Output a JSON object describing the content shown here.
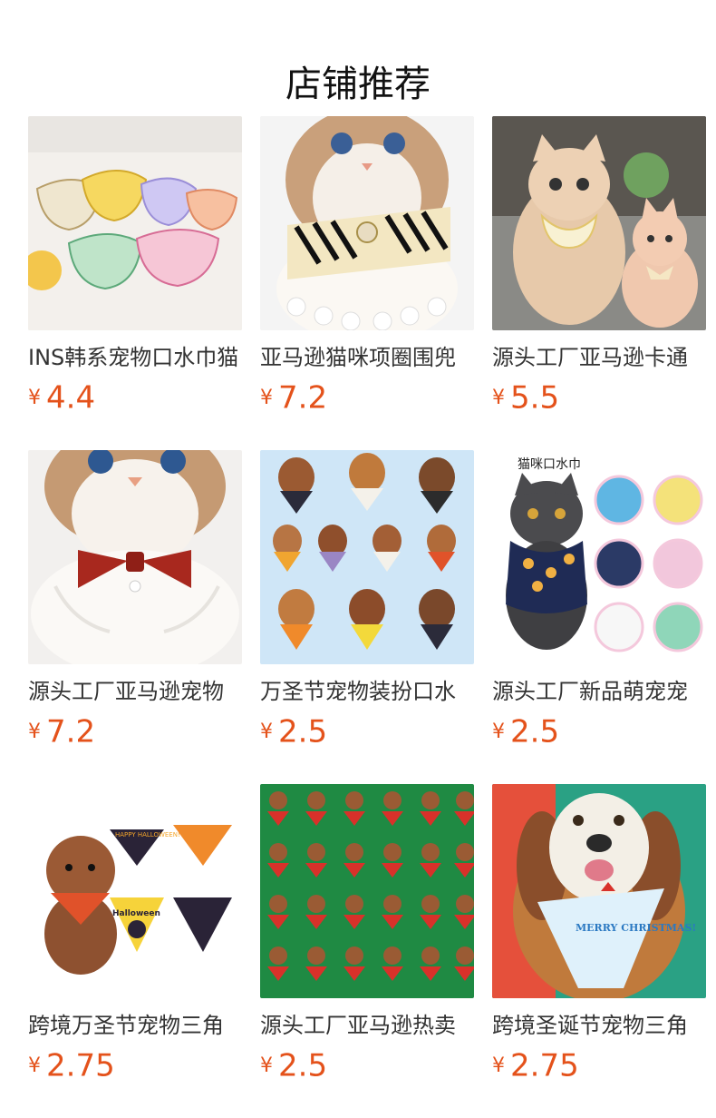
{
  "page": {
    "title": "店铺推荐"
  },
  "products": [
    {
      "name": "INS韩系宠物口水巾猫",
      "currency": "¥",
      "price": "4.4"
    },
    {
      "name": "亚马逊猫咪项圈围兜",
      "currency": "¥",
      "price": "7.2"
    },
    {
      "name": "源头工厂亚马逊卡通",
      "currency": "¥",
      "price": "5.5"
    },
    {
      "name": "源头工厂亚马逊宠物",
      "currency": "¥",
      "price": "7.2"
    },
    {
      "name": "万圣节宠物装扮口水",
      "currency": "¥",
      "price": "2.5"
    },
    {
      "name": "源头工厂新品萌宠宠",
      "currency": "¥",
      "price": "2.5"
    },
    {
      "name": "跨境万圣节宠物三角",
      "currency": "¥",
      "price": "2.75"
    },
    {
      "name": "源头工厂亚马逊热卖",
      "currency": "¥",
      "price": "2.5"
    },
    {
      "name": "跨境圣诞节宠物三角",
      "currency": "¥",
      "price": "2.75"
    }
  ],
  "image_text": {
    "cat_bib_caption": "猫咪口水巾",
    "halloween_bandana_1": "HAPPY HALLOWEEN!",
    "halloween_bandana_2": "Halloween",
    "christmas_bandana": "MERRY CHRISTMAS!"
  }
}
